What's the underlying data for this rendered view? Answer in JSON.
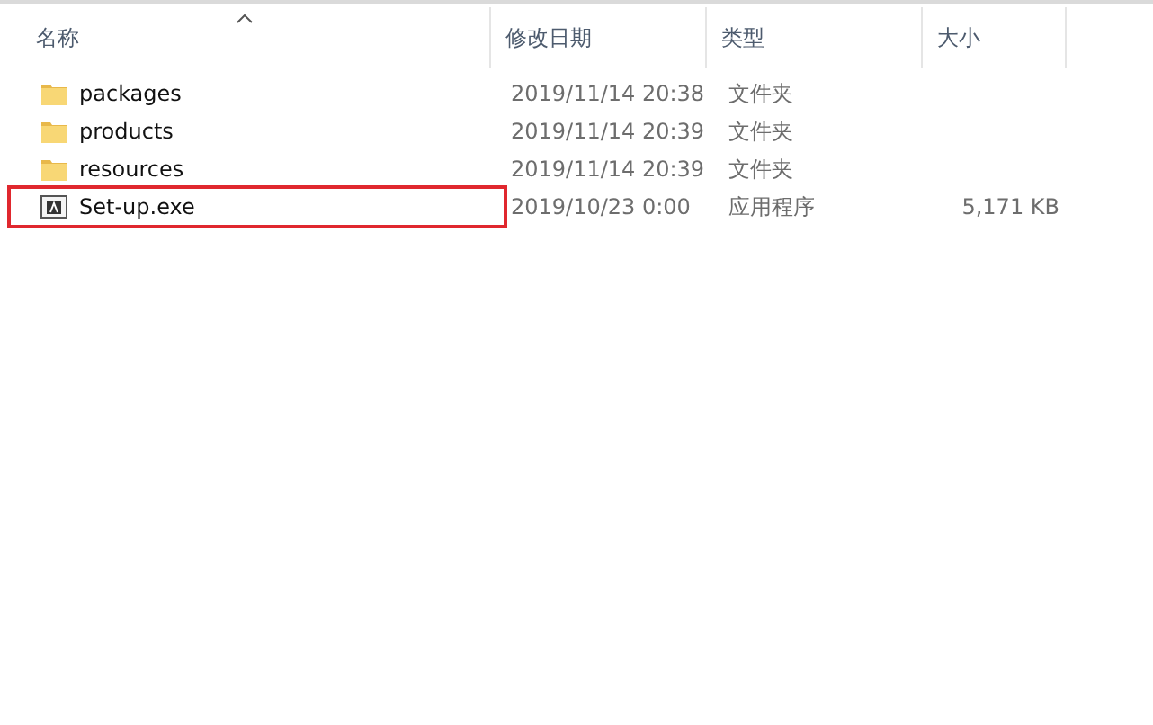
{
  "table": {
    "columns": [
      {
        "label": "名称",
        "sorted": true
      },
      {
        "label": "修改日期",
        "sorted": false
      },
      {
        "label": "类型",
        "sorted": false
      },
      {
        "label": "大小",
        "sorted": false
      }
    ],
    "rows": [
      {
        "kind": "folder",
        "name": "packages",
        "date": "2019/11/14 20:38",
        "type": "文件夹",
        "highlighted": false
      },
      {
        "kind": "folder",
        "name": "products",
        "date": "2019/11/14 20:39",
        "type": "文件夹",
        "highlighted": false
      },
      {
        "kind": "folder",
        "name": "resources",
        "date": "2019/11/14 20:39",
        "type": "文件夹",
        "highlighted": false
      },
      {
        "kind": "app",
        "name": "Set-up.exe",
        "date": "2019/10/23 0:00",
        "type": "应用程序",
        "size": "5,171 KB",
        "highlighted": true
      }
    ]
  }
}
